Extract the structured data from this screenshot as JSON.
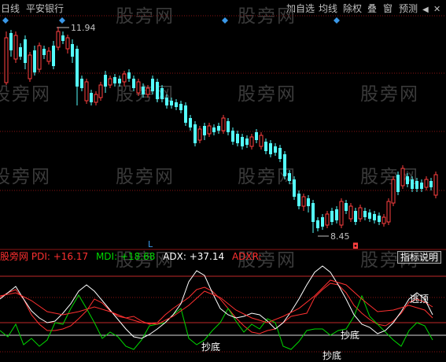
{
  "toolbar": {
    "period": "日线",
    "stock_name": "平安银行",
    "add_watch": "加自选",
    "ma_lines": "均线",
    "ex_rights": "除权",
    "overlay": "叠",
    "window": "窗",
    "forecast": "预测",
    "scroll_left": "◀",
    "close": "✕"
  },
  "price_chart": {
    "high_label": "11.94",
    "low_label": "8.45",
    "day_marker": "L",
    "flag_marker": "◘"
  },
  "indicator": {
    "name": "股旁网",
    "pdi": "PDI: +16.17",
    "mdi": "MDI: +18.68",
    "adx": "ADX: +37.14",
    "adxr": "ADXR:",
    "help": "指标说明",
    "signals": {
      "bottom": "抄底",
      "escape": "逃顶"
    }
  },
  "watermark": "股旁网",
  "colors": {
    "up": "#ff4040",
    "down": "#54fcfc",
    "pdi": "#ff3030",
    "mdi": "#00d800",
    "adx": "#ffffff",
    "adxr": "#ff3030",
    "marker": "#3a98e8",
    "toolbar_text": "#c0c0c0",
    "watermark": "#3a3a3a"
  }
}
